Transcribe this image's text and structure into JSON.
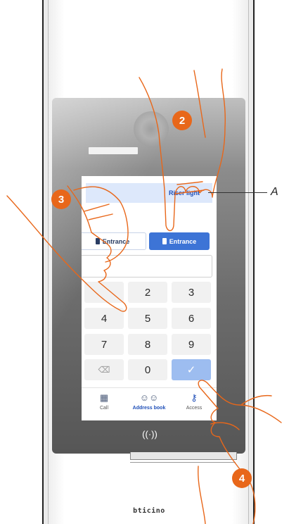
{
  "screen": {
    "banner_text": "Riser light",
    "entrance_left": "Entrance",
    "entrance_right": "Entrance",
    "code_value": ""
  },
  "keypad": {
    "keys": [
      "",
      "2",
      "3",
      "4",
      "5",
      "6",
      "7",
      "8",
      "9",
      "",
      "0",
      ""
    ],
    "backspace_symbol": "⌫",
    "confirm_symbol": "✓"
  },
  "tabs": {
    "call": "Call",
    "address_book": "Address book",
    "access": "Access"
  },
  "device": {
    "nfc_symbol": "((·))",
    "brand": "bticino"
  },
  "callouts": {
    "step_2": "2",
    "step_3": "3",
    "step_4": "4",
    "label_a": "A"
  },
  "colors": {
    "accent_blue": "#3d74d6",
    "callout_orange": "#e8671a",
    "hand_outline": "#e8671a"
  }
}
